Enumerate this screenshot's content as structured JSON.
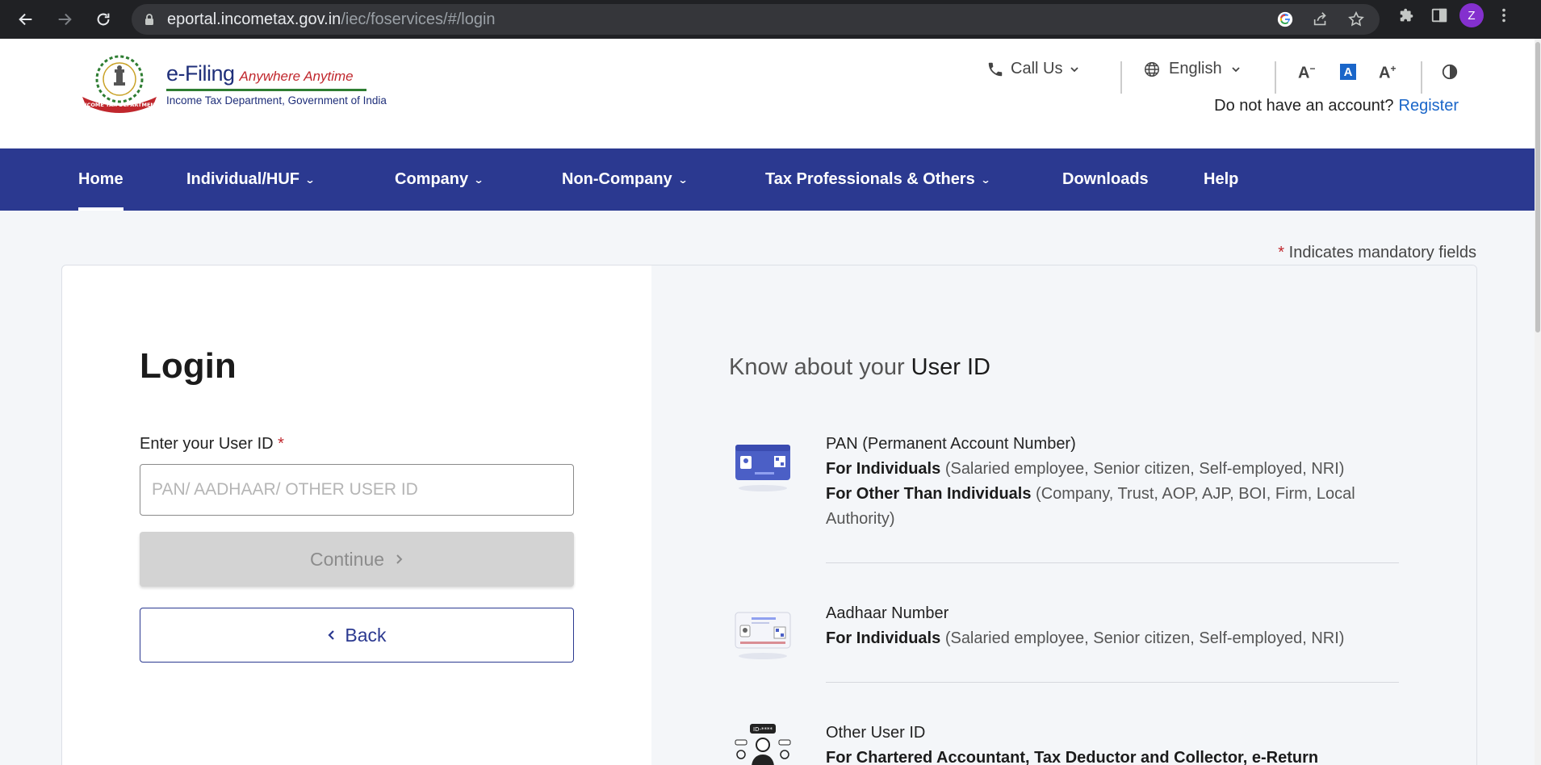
{
  "browser": {
    "url_host": "eportal.incometax.gov.in",
    "url_path": "/iec/foservices/#/login",
    "profile_initial": "Z"
  },
  "brand": {
    "emblem_text": "INCOME TAX DEPARTMENT",
    "name": "e-Filing",
    "tagline": "Anywhere Anytime",
    "department": "Income Tax Department, Government of India"
  },
  "header": {
    "call_us": "Call Us",
    "language": "English",
    "font_decrease": "A",
    "font_normal": "A",
    "font_increase": "A",
    "account_prompt": "Do not have an account?",
    "register": "Register"
  },
  "nav": {
    "items": [
      {
        "label": "Home"
      },
      {
        "label": "Individual/HUF"
      },
      {
        "label": "Company"
      },
      {
        "label": "Non-Company"
      },
      {
        "label": "Tax Professionals & Others"
      },
      {
        "label": "Downloads"
      },
      {
        "label": "Help"
      }
    ]
  },
  "mandatory_note": "Indicates mandatory fields",
  "login": {
    "title": "Login",
    "user_id_label": "Enter your User ID",
    "user_id_value": "",
    "user_id_placeholder": "PAN/ AADHAAR/ OTHER USER ID",
    "continue_label": "Continue",
    "back_label": "Back"
  },
  "info": {
    "heading_prefix": "Know about your",
    "heading_highlight": "User ID",
    "entries": [
      {
        "title": "PAN (Permanent Account Number)",
        "lines": [
          {
            "bold": "For Individuals",
            "rest": "(Salaried employee, Senior citizen, Self-employed, NRI)"
          },
          {
            "bold": "For Other Than Individuals",
            "rest": "(Company, Trust, AOP, AJP, BOI, Firm, Local Authority)"
          }
        ]
      },
      {
        "title": "Aadhaar Number",
        "lines": [
          {
            "bold": "For Individuals",
            "rest": "(Salaried employee, Senior citizen, Self-employed, NRI)"
          }
        ]
      },
      {
        "title": "Other User ID",
        "lines": [
          {
            "bold": "For Chartered Accountant, Tax Deductor and Collector, e-Return",
            "rest": ""
          }
        ]
      }
    ]
  }
}
